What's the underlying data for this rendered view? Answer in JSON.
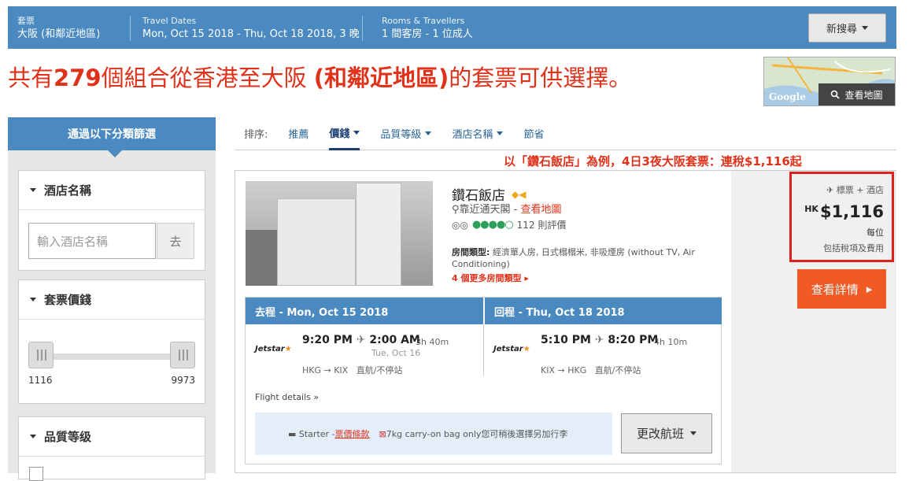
{
  "search_bar": {
    "package": {
      "label": "套票",
      "value": "大阪 (和鄰近地區)"
    },
    "dates": {
      "label": "Travel Dates",
      "value": "Mon, Oct 15 2018 - Thu, Oct 18 2018, 3 晚"
    },
    "rooms": {
      "label": "Rooms & Travellers",
      "value": "1 間客房 - 1 位成人"
    },
    "new_search_label": "新搜尋"
  },
  "headline": {
    "prefix": "共有",
    "count": "279",
    "middle": "個組合從香港至大阪 ",
    "bold_part": "(和鄰近地區)",
    "suffix": "的套票可供選擇。"
  },
  "map": {
    "google_label": "Google",
    "button_label": "查看地圖"
  },
  "filters": {
    "title": "通過以下分類篩選",
    "hotel_name": {
      "title": "酒店名稱",
      "placeholder": "輸入酒店名稱",
      "go_label": "去"
    },
    "price": {
      "title": "套票價錢",
      "min": "1116",
      "max": "9973"
    },
    "quality": {
      "title": "品質等级"
    }
  },
  "sort": {
    "label": "排序:",
    "items": [
      "推薦",
      "價錢",
      "品質等級",
      "酒店名稱",
      "節省"
    ]
  },
  "promo_text": "以「鑽石飯店」為例，4日3夜大阪套票：連稅$1,116起",
  "hotel": {
    "name": "鑽石飯店",
    "location": "靠近通天閣 - ",
    "map_link": "查看地圖",
    "reviews": "112 則評價",
    "room_label": "房間類型:",
    "room_value": " 經濟單人房, 日式榻榻米, 非吸煙房 (without TV, Air Conditioning)",
    "more_rooms": "4 個更多房間類型"
  },
  "flights": {
    "outbound": {
      "header": "去程 - Mon, Oct 15 2018",
      "airline": "Jetstar",
      "depart": "9:20 PM",
      "arrive": "2:00 AM",
      "duration": "3h 40m",
      "arrive_date": "Tue, Oct 16",
      "route": "HKG → KIX",
      "stops": "直航/不停站"
    },
    "return": {
      "header": "回程 - Thu, Oct 18 2018",
      "airline": "Jetstar",
      "depart": "5:10 PM",
      "arrive": "8:20 PM",
      "duration": "4h 10m",
      "route": "KIX → HKG",
      "stops": "直航/不停站"
    },
    "details_label": "Flight details",
    "fare": {
      "starter": "Starter - ",
      "rules_link": "票價條款",
      "bag": "7kg carry-on bag only您可稍後選擇另加行李"
    },
    "change_label": "更改航班"
  },
  "price": {
    "type": "標票 + 酒店",
    "currency": "HK",
    "amount": "$1,116",
    "per": "每位",
    "tax": "包括稅項及費用",
    "details_label": "查看詳情"
  },
  "colors": {
    "brand_blue": "#4a8ac1",
    "accent_red": "#e0321a",
    "cta_orange": "#f15a24"
  }
}
